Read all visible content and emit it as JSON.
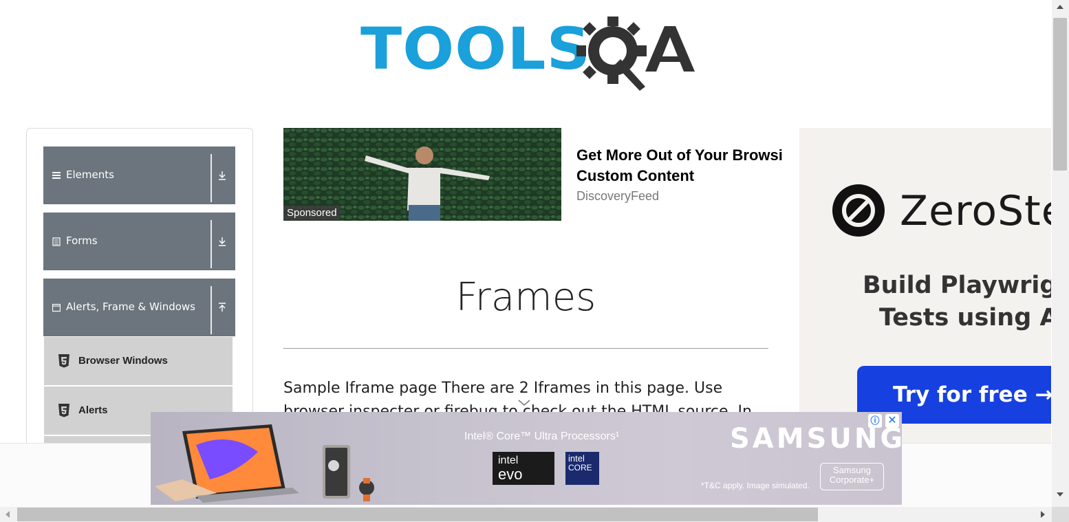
{
  "logo": {
    "text": "TOOLS",
    "text_color": "#1aa0da",
    "gear_color": "#333333",
    "alt_text": "TOOLSQA"
  },
  "sidebar": {
    "groups": [
      {
        "label": "Elements",
        "icon": "hamburger-icon",
        "toggle_icon": "download-arrow-icon"
      },
      {
        "label": "Forms",
        "icon": "document-icon",
        "toggle_icon": "download-arrow-icon"
      },
      {
        "label": "Alerts, Frame & Windows",
        "icon": "window-icon",
        "toggle_icon": "upload-arrow-icon"
      }
    ],
    "items": [
      {
        "label": "Browser Windows",
        "icon": "html5-icon"
      },
      {
        "label": "Alerts",
        "icon": "html5-icon"
      }
    ],
    "group_color": "#6c757d",
    "item_color": "#d1d1d1"
  },
  "sponsored": {
    "tag": "Sponsored",
    "title_line1": "Get More Out of Your Browsi",
    "title_line2": "Custom Content",
    "source": "DiscoveryFeed"
  },
  "right_ad": {
    "brand": "ZeroSte",
    "tagline_line1": "Build Playwrigh",
    "tagline_line2": "Tests using A",
    "cta": "Try for free →",
    "cta_color": "#1640e0"
  },
  "main": {
    "title": "Frames",
    "intro": "Sample Iframe page There are 2 Iframes in this page. Use browser inspecter or firebug to check out the HTML source. In total you"
  },
  "bottom_ad": {
    "headline": "Intel® Core™ Ultra Processors¹",
    "evo_top": "intel",
    "evo_bottom": "evo",
    "core_top": "intel",
    "core_bottom": "CORE",
    "brand": "SAMSUNG",
    "fine_print": "*T&C apply. Image simulated.",
    "corp_line1": "Samsung",
    "corp_line2": "Corporate+",
    "info_glyph": "ⓘ",
    "close_glyph": "✕"
  }
}
